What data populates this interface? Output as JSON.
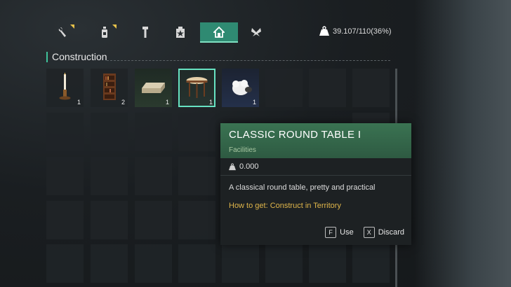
{
  "colors": {
    "accent": "#2f8a72",
    "highlight": "#67e3c2",
    "gold": "#e0b64a",
    "badge": "#e6c14a"
  },
  "tabs": [
    {
      "name": "tab-tools",
      "icon": "wrench-icon",
      "active": false,
      "badge": true
    },
    {
      "name": "tab-consumables",
      "icon": "bottle-icon",
      "active": false,
      "badge": true
    },
    {
      "name": "tab-materials",
      "icon": "bolt-icon",
      "active": false,
      "badge": false
    },
    {
      "name": "tab-quests",
      "icon": "star-box-icon",
      "active": false,
      "badge": false
    },
    {
      "name": "tab-construction",
      "icon": "house-icon",
      "active": true,
      "badge": false
    },
    {
      "name": "tab-special",
      "icon": "butterfly-icon",
      "active": false,
      "badge": false
    }
  ],
  "weight": {
    "icon": "weight-icon",
    "text": "39.107/110(36%)"
  },
  "section": {
    "title": "Construction"
  },
  "items": [
    {
      "icon": "candlestick-icon",
      "qty": "1",
      "quality": "grey"
    },
    {
      "icon": "bookshelf-icon",
      "qty": "2",
      "quality": "grey"
    },
    {
      "icon": "low-table-icon",
      "qty": "1",
      "quality": "green"
    },
    {
      "icon": "round-table-icon",
      "qty": "1",
      "quality": "green",
      "selected": true
    },
    {
      "icon": "sheep-icon",
      "qty": "1",
      "quality": "blue"
    }
  ],
  "tooltip": {
    "title": "CLASSIC ROUND TABLE I",
    "category": "Facilities",
    "weight": "0.000",
    "description": "A classical round table, pretty and practical",
    "how_to_get": "How to get: Construct in Territory",
    "use_key": "F",
    "use_label": "Use",
    "discard_key": "X",
    "discard_label": "Discard"
  }
}
